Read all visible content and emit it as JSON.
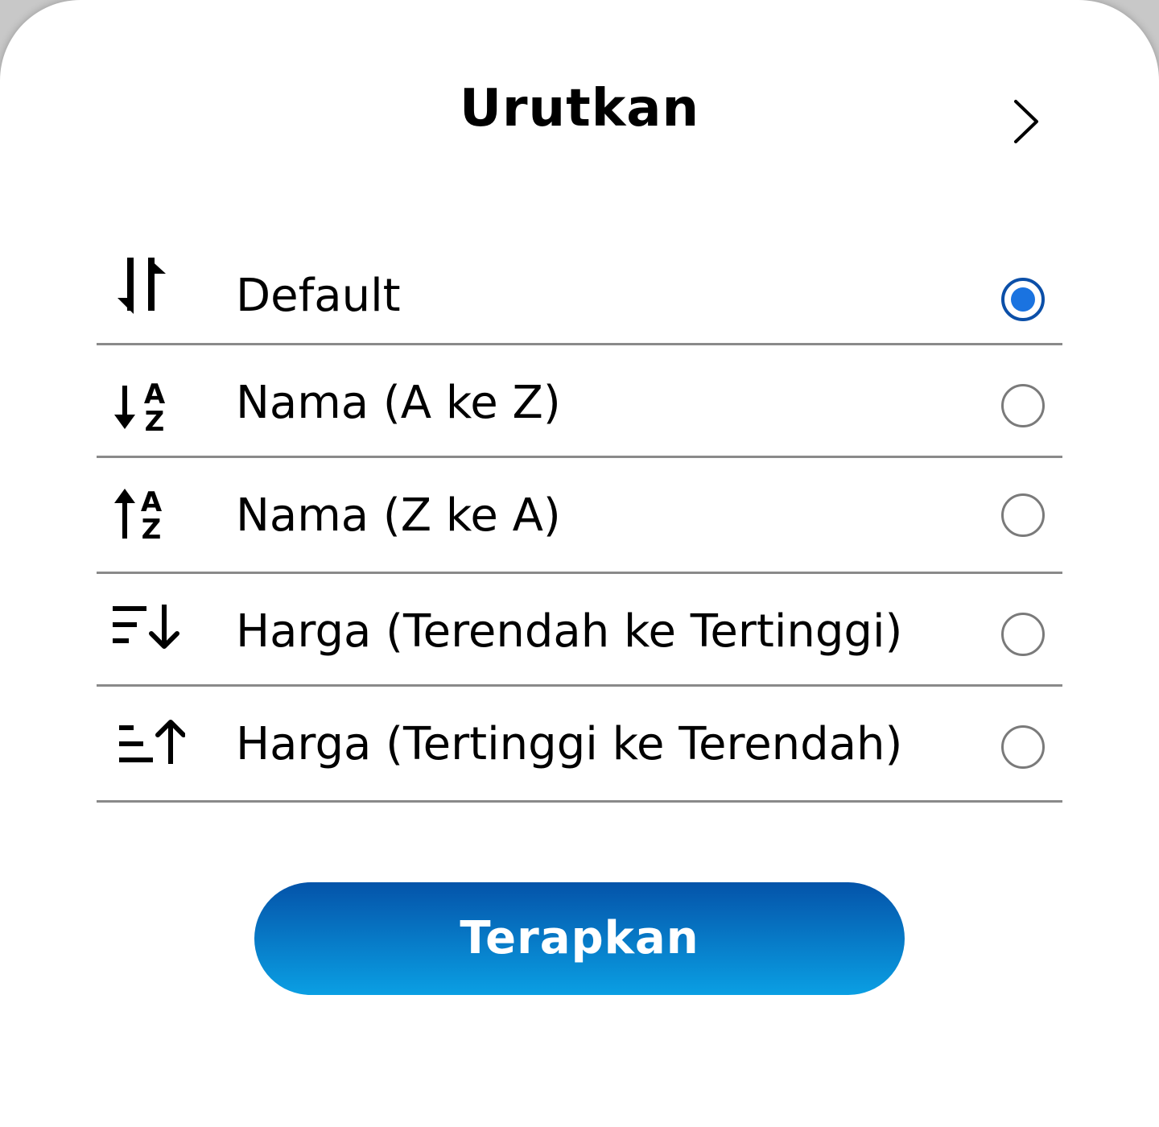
{
  "sheet": {
    "title": "Urutkan",
    "close_icon": "chevron-right-icon"
  },
  "sort_options": [
    {
      "label": "Default",
      "icon": "sort-arrows-icon",
      "selected": true
    },
    {
      "label": "Nama (A ke Z)",
      "icon": "sort-alpha-down-icon",
      "selected": false
    },
    {
      "label": "Nama (Z ke A)",
      "icon": "sort-alpha-up-icon",
      "selected": false
    },
    {
      "label": "Harga (Terendah ke Tertinggi)",
      "icon": "sort-amount-down-icon",
      "selected": false
    },
    {
      "label": "Harga (Tertinggi ke Terendah)",
      "icon": "sort-amount-up-icon",
      "selected": false
    }
  ],
  "apply_button": {
    "label": "Terapkan"
  },
  "colors": {
    "accent": "#1a73e0",
    "button_gradient_top": "#0453a9",
    "button_gradient_bottom": "#0a9fe3",
    "divider": "#8a8a8a"
  }
}
